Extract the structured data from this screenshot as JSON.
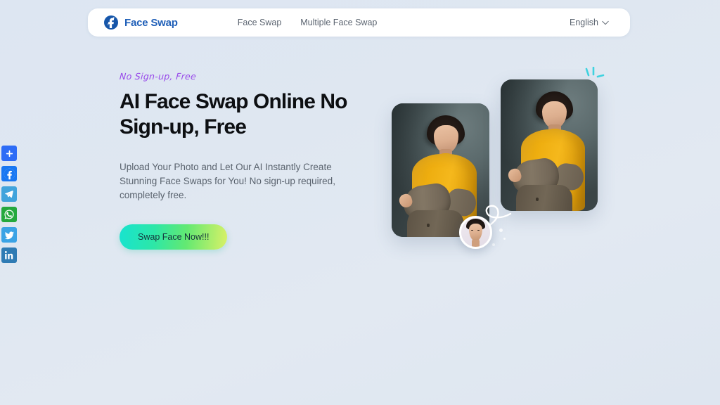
{
  "page": {
    "background_color": "#dfe7f1"
  },
  "social_rail": {
    "items": [
      {
        "name": "share-button",
        "label": "Share",
        "icon": "plus-icon",
        "color": "#2d6cf6"
      },
      {
        "name": "facebook-button",
        "label": "Facebook",
        "icon": "facebook-icon",
        "color": "#1877f2"
      },
      {
        "name": "telegram-button",
        "label": "Telegram",
        "icon": "telegram-icon",
        "color": "#41a4dc"
      },
      {
        "name": "whatsapp-button",
        "label": "WhatsApp",
        "icon": "whatsapp-icon",
        "color": "#25a93e"
      },
      {
        "name": "twitter-button",
        "label": "Twitter",
        "icon": "twitter-icon",
        "color": "#3ba3e5"
      },
      {
        "name": "linkedin-button",
        "label": "LinkedIn",
        "icon": "linkedin-icon",
        "color": "#2f7bb4"
      }
    ]
  },
  "header": {
    "brand_name": "Face Swap",
    "brand_color": "#1f5fb8",
    "nav_links": [
      {
        "label": "Face Swap"
      },
      {
        "label": "Multiple Face Swap"
      }
    ],
    "language": {
      "selected": "English",
      "options": [
        "English"
      ]
    }
  },
  "hero": {
    "eyebrow": "No Sign-up, Free",
    "eyebrow_color": "#9747ea",
    "title": "AI Face Swap Online No Sign-up, Free",
    "description": "Upload Your Photo and Let Our AI Instantly Create Stunning Face Swaps for You! No sign-up required, completely free.",
    "cta_label": "Swap Face Now!!!",
    "cta_gradient": [
      "#18e3cf",
      "#63e972",
      "#d9f167"
    ],
    "media": {
      "source_photo_alt": "Man in yellow turtleneck - source photo",
      "result_photo_alt": "Man in yellow turtleneck - face swapped result",
      "face_avatar_alt": "Replacement face thumbnail",
      "sparkle_color": "#3fd3e0"
    }
  }
}
